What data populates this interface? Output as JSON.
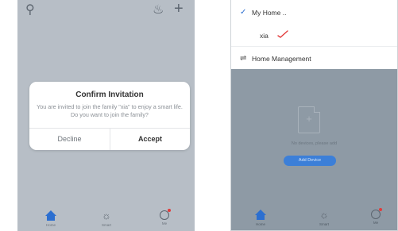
{
  "left_screen": {
    "dialog": {
      "title": "Confirm Invitation",
      "message": "You are invited to join the family \"xia\" to enjoy a smart life. Do you want to join the family?",
      "decline_label": "Decline",
      "accept_label": "Accept"
    },
    "bottom_nav": [
      {
        "label": "Home",
        "icon": "home-icon"
      },
      {
        "label": "Smart",
        "icon": "sun-icon"
      },
      {
        "label": "Me",
        "icon": "me-icon"
      }
    ]
  },
  "right_screen": {
    "menu": {
      "current_home": "My Home ..",
      "other_home": "xia",
      "management_label": "Home Management"
    },
    "empty_state": {
      "message": "No devices, please add",
      "add_button_label": "Add Device"
    },
    "bottom_nav": [
      {
        "label": "Home",
        "icon": "home-icon"
      },
      {
        "label": "Smart",
        "icon": "sun-icon"
      },
      {
        "label": "Me",
        "icon": "me-icon"
      }
    ]
  },
  "colors": {
    "accent_blue": "#2c6fd0",
    "annotation_red": "#e23b3b",
    "overlay_gray": "#b7bec6"
  }
}
